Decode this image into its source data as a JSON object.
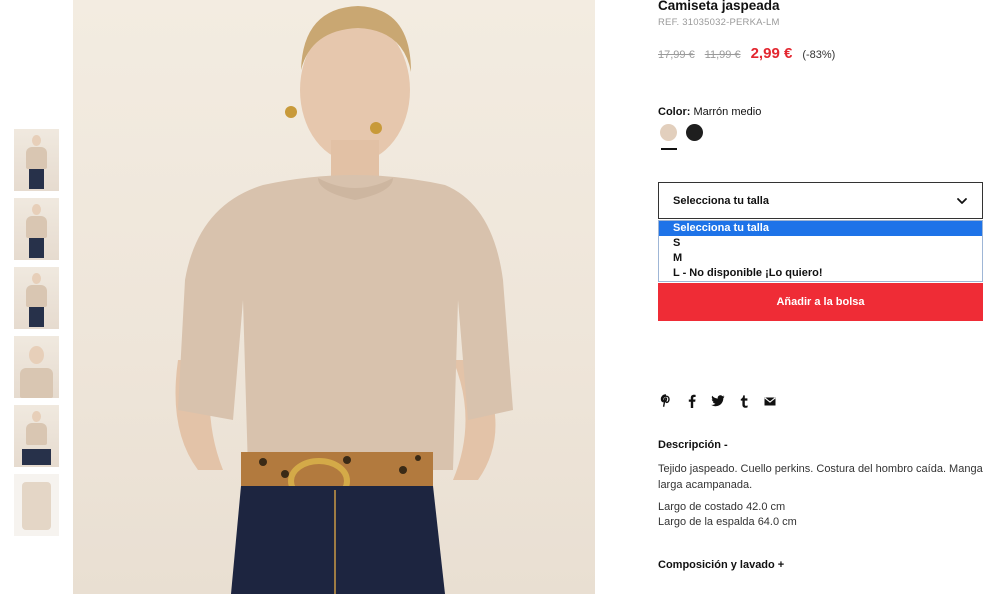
{
  "product": {
    "title": "Camiseta jaspeada",
    "ref": "REF. 31035032-PERKA-LM",
    "price_old_1": "17,99 €",
    "price_old_2": "11,99 €",
    "price_current": "2,99 €",
    "discount": "(-83%)",
    "color_label": "Color:",
    "color_value": "Marrón medio",
    "swatches": [
      {
        "name": "Marrón medio",
        "color": "#e2cfbd",
        "selected": true
      },
      {
        "name": "Negro",
        "color": "#1e1e1e",
        "selected": false
      }
    ]
  },
  "size_select": {
    "value": "Selecciona tu talla",
    "options": [
      "Selecciona tu talla",
      "S",
      "M",
      "L - No disponible ¡Lo quiero!"
    ],
    "highlighted_index": 0
  },
  "actions": {
    "add_to_bag": "Añadir a la bolsa"
  },
  "share_icons": [
    "pinterest-icon",
    "facebook-icon",
    "twitter-icon",
    "tumblr-icon",
    "email-icon"
  ],
  "description": {
    "title": "Descripción  -",
    "text": "Tejido jaspeado. Cuello perkins. Costura del hombro caída. Manga larga acampanada.",
    "measure_1": "Largo de costado 42.0 cm",
    "measure_2": "Largo de la espalda 64.0 cm"
  },
  "composition": {
    "title": "Composición y lavado  +"
  },
  "colors": {
    "accent_red": "#ef2c36",
    "price_red": "#e3262f",
    "highlight_blue": "#1e73e8"
  },
  "thumbnails": [
    "front",
    "full",
    "side",
    "closeup",
    "seated",
    "flat"
  ]
}
